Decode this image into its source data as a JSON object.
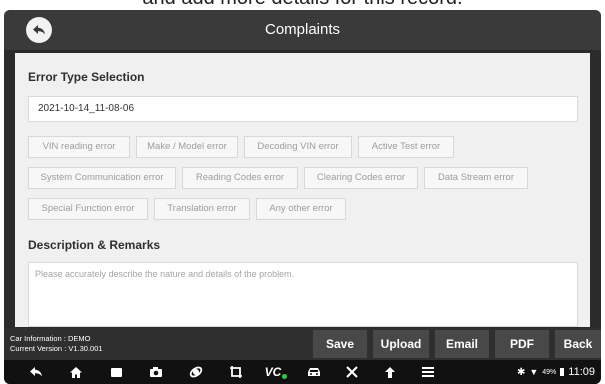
{
  "caption": "and add more details for this record.",
  "header": {
    "title": "Complaints"
  },
  "error_section": {
    "title": "Error Type Selection",
    "record_date": "2021-10-14_11-08-06",
    "chips": [
      "VIN reading error",
      "Make / Model error",
      "Decoding VIN error",
      "Active Test error",
      "System Communication error",
      "Reading Codes error",
      "Clearing Codes error",
      "Data Stream error",
      "Special Function error",
      "Translation error",
      "Any other error"
    ]
  },
  "description_section": {
    "title": "Description & Remarks",
    "placeholder": "Please accurately describe the nature and details of the problem."
  },
  "footer": {
    "car_info": "Car Information : DEMO",
    "version": "Current Version : V1.30.001",
    "buttons": {
      "save": "Save",
      "upload": "Upload",
      "email": "Email",
      "pdf": "PDF",
      "back": "Back"
    }
  },
  "navbar": {
    "icons": [
      "back-icon",
      "home-icon",
      "recent-apps-icon",
      "camera-icon",
      "browser-icon",
      "screenshot-icon",
      "vci-icon",
      "car-icon",
      "tools-icon",
      "upload-arrow-icon",
      "menu-icon"
    ],
    "vci_label": "VC",
    "battery": "49%",
    "time": "11:09"
  }
}
